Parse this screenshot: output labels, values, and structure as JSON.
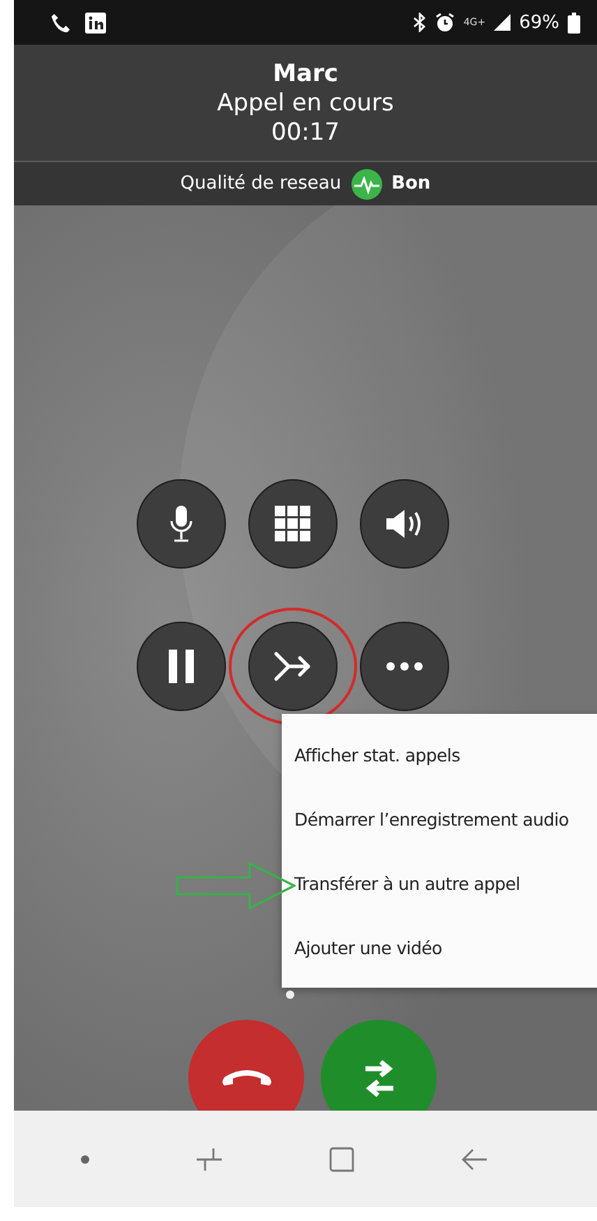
{
  "status_bar": {
    "network": "4G+",
    "battery": "69%",
    "left_icons": [
      {
        "kind": "phone"
      },
      {
        "kind": "linkedin"
      }
    ]
  },
  "call": {
    "name": "Marc",
    "status": "Appel en cours",
    "duration": "00:17"
  },
  "network_quality": {
    "label": "Qualité de reseau",
    "value": "Bon"
  },
  "controls": [
    {
      "kind": "mic",
      "annotated": false
    },
    {
      "kind": "keypad",
      "annotated": false
    },
    {
      "kind": "speaker",
      "annotated": false
    },
    {
      "kind": "hold",
      "annotated": false
    },
    {
      "kind": "transfer",
      "annotated": true
    },
    {
      "kind": "more",
      "annotated": false
    }
  ],
  "menu": {
    "items": [
      {
        "label": "Afficher stat. appels",
        "annotated": false
      },
      {
        "label": "Démarrer l’enregistrement audio",
        "annotated": false
      },
      {
        "label": "Transférer à un autre appel",
        "annotated": true
      },
      {
        "label": "Ajouter une vidéo",
        "annotated": false
      }
    ]
  },
  "page_dots": [
    {
      "selected": true
    }
  ],
  "actions": [
    {
      "kind": "end_call"
    },
    {
      "kind": "swap"
    }
  ],
  "nav_bar": [
    {
      "kind": "dot"
    },
    {
      "kind": "recents"
    },
    {
      "kind": "home"
    },
    {
      "kind": "back"
    }
  ]
}
